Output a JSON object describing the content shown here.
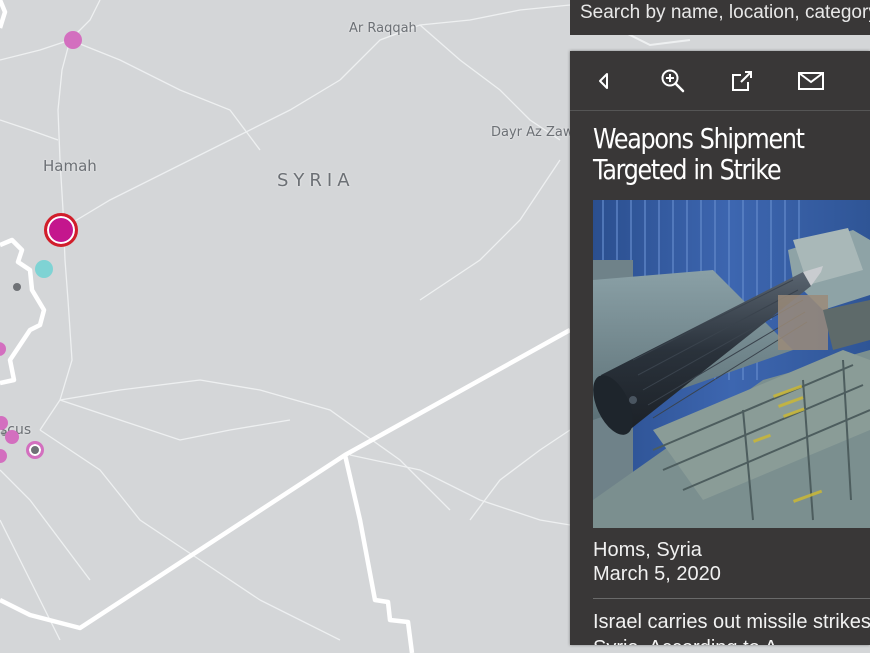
{
  "map": {
    "labels": {
      "raqqah": "Ar Raqqah",
      "dayr": "Dayr Az Zawr",
      "hamah": "Hamah",
      "syria": "SYRIA",
      "damascus": "scus"
    }
  },
  "search": {
    "text": "Search by name, location, category"
  },
  "panel": {
    "toolbar": {
      "back_icon": "back-icon",
      "zoom_icon": "zoom-in-icon",
      "share_icon": "share-icon",
      "email_icon": "email-icon"
    },
    "title": "Weapons Shipment Targeted in Strike",
    "location": "Homs, Syria",
    "date": "March 5, 2020",
    "description": "Israel carries out missile strikes in southern Syria. According to A"
  },
  "colors": {
    "panel_bg": "#393737",
    "map_bg": "#d4d6d8",
    "marker_pink": "#d36fbf",
    "marker_selected": "#c4168d",
    "marker_selected_ring": "#d11e2a",
    "marker_teal": "#7fd3d4"
  }
}
